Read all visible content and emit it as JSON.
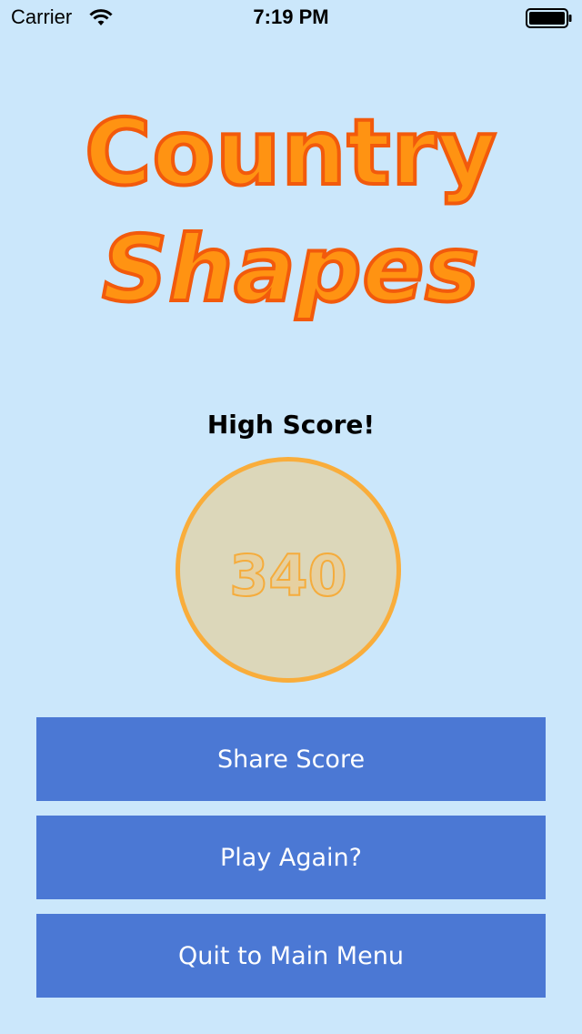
{
  "status_bar": {
    "carrier": "Carrier",
    "time": "7:19 PM",
    "wifi_icon": "wifi-icon",
    "battery_icon": "battery-icon"
  },
  "title": {
    "line1": "Country",
    "line2": "Shapes"
  },
  "result": {
    "label": "High Score!",
    "score": "340"
  },
  "buttons": {
    "share": "Share Score",
    "play_again": "Play Again?",
    "quit": "Quit to Main Menu"
  },
  "colors": {
    "background": "#cbe7fb",
    "title_fill": "#ff9312",
    "title_stroke": "#f25a0c",
    "score_circle_fill": "#dcd7ba",
    "score_circle_border": "#f9ad3b",
    "button": "#4b78d4"
  }
}
